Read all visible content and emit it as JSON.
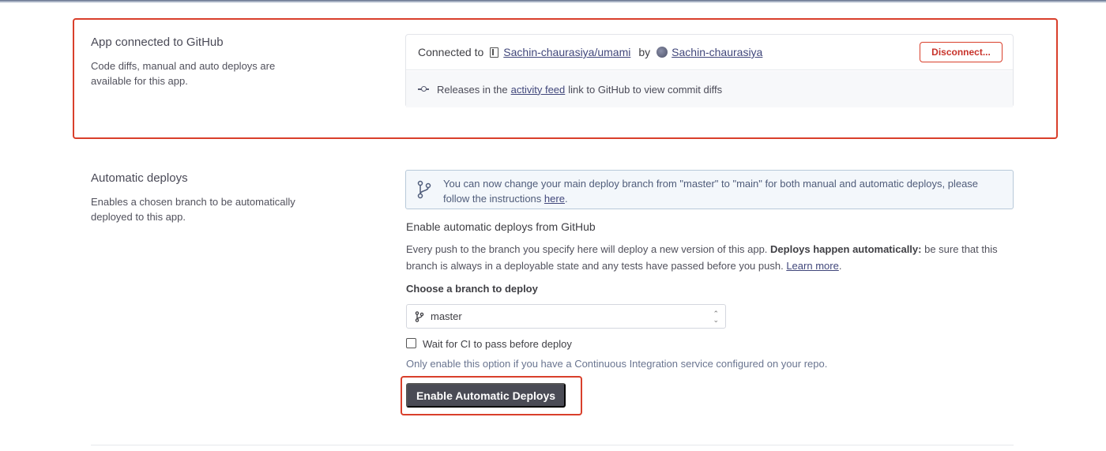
{
  "github_section": {
    "title": "App connected to GitHub",
    "description": "Code diffs, manual and auto deploys are available for this app.",
    "connected_to_label": "Connected to",
    "repo": "Sachin-chaurasiya/umami",
    "by_label": "by",
    "user": "Sachin-chaurasiya",
    "disconnect_label": "Disconnect...",
    "releases_prefix": "Releases in the",
    "activity_feed_link": "activity feed",
    "releases_suffix": "link to GitHub to view commit diffs"
  },
  "auto_deploy_section": {
    "title": "Automatic deploys",
    "description": "Enables a chosen branch to be automatically deployed to this app.",
    "notice_text": "You can now change your main deploy branch from \"master\" to \"main\" for both manual and automatic deploys, please follow the instructions",
    "notice_link": "here",
    "notice_end": ".",
    "enable_heading": "Enable automatic deploys from GitHub",
    "para_text": "Every push to the branch you specify here will deploy a new version of this app.",
    "para_bold": "Deploys happen automatically:",
    "para_text2": "be sure that this branch is always in a deployable state and any tests have passed before you push.",
    "learn_more": "Learn more",
    "para_end": ".",
    "choose_branch_label": "Choose a branch to deploy",
    "selected_branch": "master",
    "wait_ci_label": "Wait for CI to pass before deploy",
    "wait_ci_checked": false,
    "ci_note": "Only enable this option if you have a Continuous Integration service configured on your repo.",
    "enable_button": "Enable Automatic Deploys"
  },
  "colors": {
    "highlight": "#d93f2b",
    "link": "#41477b",
    "button_bg": "#4a4b55"
  }
}
